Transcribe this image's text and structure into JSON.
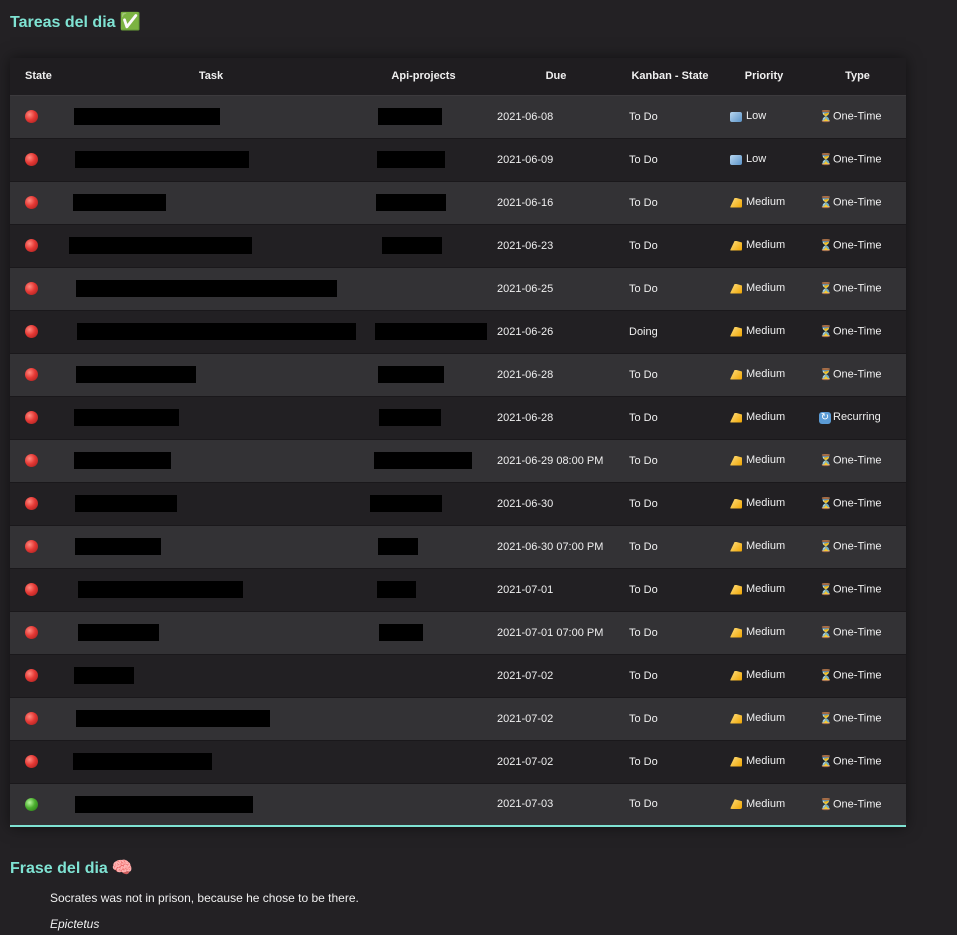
{
  "tasks_section": {
    "title": "Tareas del dia",
    "emoji": "✅"
  },
  "columns": [
    "State",
    "Task",
    "Api-projects",
    "Due",
    "Kanban - State",
    "Priority",
    "Type"
  ],
  "rows": [
    {
      "state": "red",
      "due": "2021-06-08",
      "kanban": "To Do",
      "priority": "Low",
      "priority_icon": "ice-cube-icon",
      "type": "One-Time",
      "type_icon": "hourglass-icon"
    },
    {
      "state": "red",
      "due": "2021-06-09",
      "kanban": "To Do",
      "priority": "Low",
      "priority_icon": "ice-cube-icon",
      "type": "One-Time",
      "type_icon": "hourglass-icon"
    },
    {
      "state": "red",
      "due": "2021-06-16",
      "kanban": "To Do",
      "priority": "Medium",
      "priority_icon": "cheese-icon",
      "type": "One-Time",
      "type_icon": "hourglass-icon"
    },
    {
      "state": "red",
      "due": "2021-06-23",
      "kanban": "To Do",
      "priority": "Medium",
      "priority_icon": "cheese-icon",
      "type": "One-Time",
      "type_icon": "hourglass-icon"
    },
    {
      "state": "red",
      "due": "2021-06-25",
      "kanban": "To Do",
      "priority": "Medium",
      "priority_icon": "cheese-icon",
      "type": "One-Time",
      "type_icon": "hourglass-icon"
    },
    {
      "state": "red",
      "due": "2021-06-26",
      "kanban": "Doing",
      "priority": "Medium",
      "priority_icon": "cheese-icon",
      "type": "One-Time",
      "type_icon": "hourglass-icon"
    },
    {
      "state": "red",
      "due": "2021-06-28",
      "kanban": "To Do",
      "priority": "Medium",
      "priority_icon": "cheese-icon",
      "type": "One-Time",
      "type_icon": "hourglass-icon"
    },
    {
      "state": "red",
      "due": "2021-06-28",
      "kanban": "To Do",
      "priority": "Medium",
      "priority_icon": "cheese-icon",
      "type": "Recurring",
      "type_icon": "recurring-icon"
    },
    {
      "state": "red",
      "due": "2021-06-29 08:00 PM",
      "kanban": "To Do",
      "priority": "Medium",
      "priority_icon": "cheese-icon",
      "type": "One-Time",
      "type_icon": "hourglass-icon"
    },
    {
      "state": "red",
      "due": "2021-06-30",
      "kanban": "To Do",
      "priority": "Medium",
      "priority_icon": "cheese-icon",
      "type": "One-Time",
      "type_icon": "hourglass-icon"
    },
    {
      "state": "red",
      "due": "2021-06-30 07:00 PM",
      "kanban": "To Do",
      "priority": "Medium",
      "priority_icon": "cheese-icon",
      "type": "One-Time",
      "type_icon": "hourglass-icon"
    },
    {
      "state": "red",
      "due": "2021-07-01",
      "kanban": "To Do",
      "priority": "Medium",
      "priority_icon": "cheese-icon",
      "type": "One-Time",
      "type_icon": "hourglass-icon"
    },
    {
      "state": "red",
      "due": "2021-07-01 07:00 PM",
      "kanban": "To Do",
      "priority": "Medium",
      "priority_icon": "cheese-icon",
      "type": "One-Time",
      "type_icon": "hourglass-icon"
    },
    {
      "state": "red",
      "due": "2021-07-02",
      "kanban": "To Do",
      "priority": "Medium",
      "priority_icon": "cheese-icon",
      "type": "One-Time",
      "type_icon": "hourglass-icon"
    },
    {
      "state": "red",
      "due": "2021-07-02",
      "kanban": "To Do",
      "priority": "Medium",
      "priority_icon": "cheese-icon",
      "type": "One-Time",
      "type_icon": "hourglass-icon"
    },
    {
      "state": "red",
      "due": "2021-07-02",
      "kanban": "To Do",
      "priority": "Medium",
      "priority_icon": "cheese-icon",
      "type": "One-Time",
      "type_icon": "hourglass-icon"
    },
    {
      "state": "green",
      "due": "2021-07-03",
      "kanban": "To Do",
      "priority": "Medium",
      "priority_icon": "cheese-icon",
      "type": "One-Time",
      "type_icon": "hourglass-icon"
    }
  ],
  "quote_section": {
    "title": "Frase del dia",
    "emoji": "🧠",
    "quote": "Socrates was not in prison, because he chose to be there.",
    "author": "Epictetus"
  },
  "colors": {
    "accent": "#7fe3d3",
    "background": "#232124"
  }
}
